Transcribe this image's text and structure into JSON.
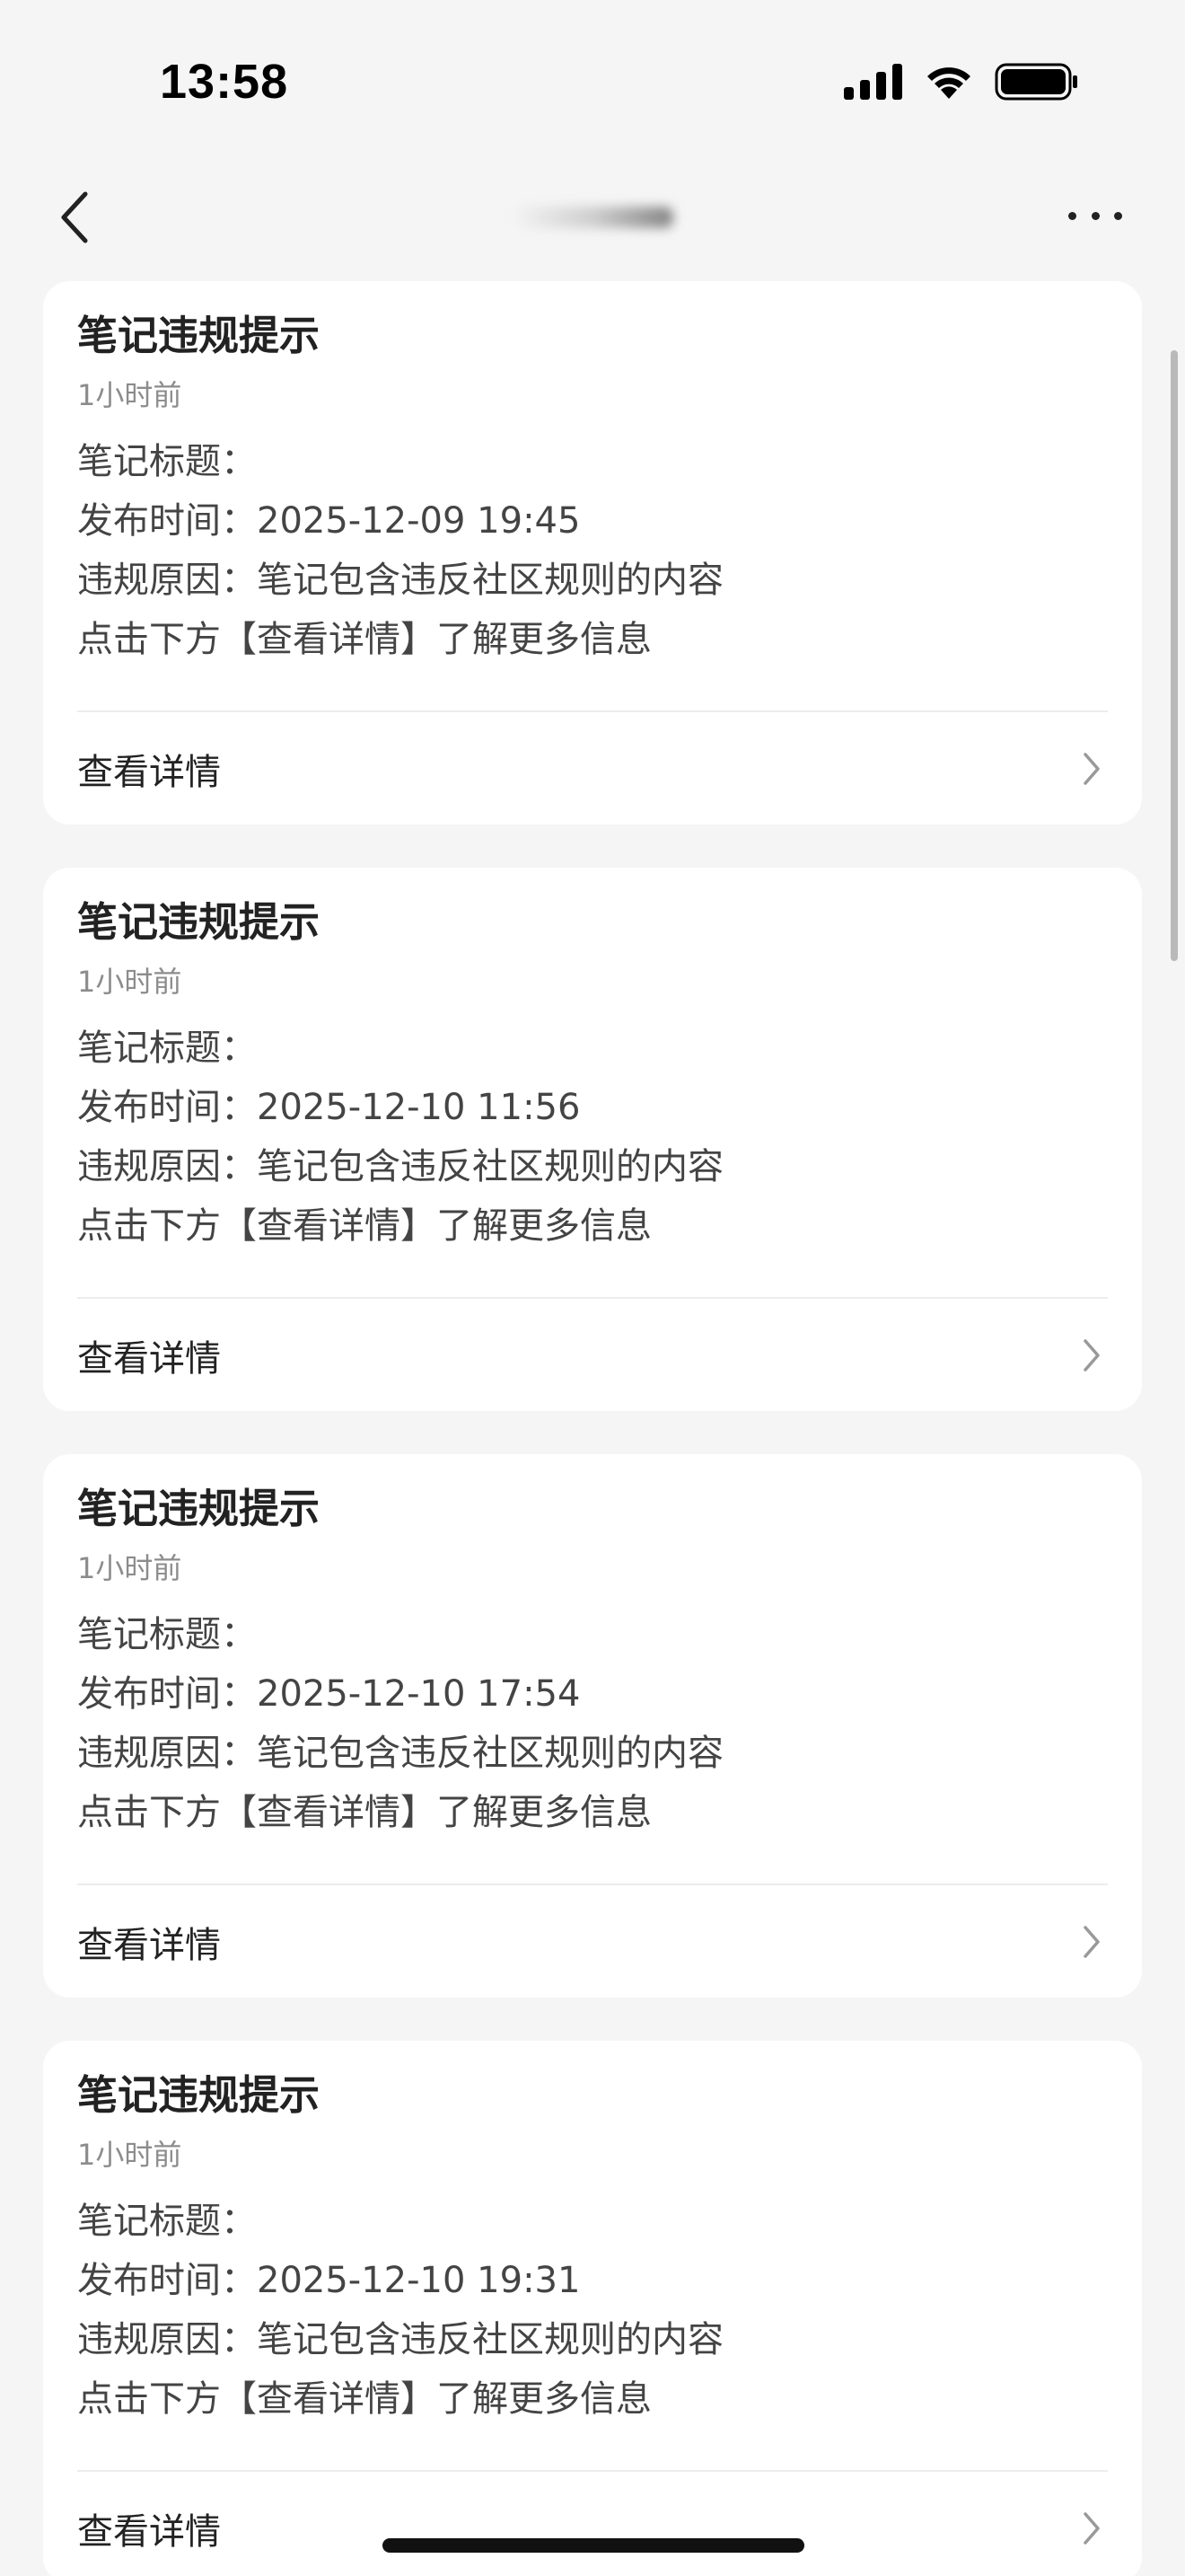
{
  "status_bar": {
    "time": "13:58",
    "icons": [
      "cellular-signal-icon",
      "wifi-icon",
      "battery-icon"
    ]
  },
  "nav": {
    "back_icon": "chevron-left-icon",
    "more_icon": "more-horizontal-icon"
  },
  "cards": [
    {
      "title": "笔记违规提示",
      "time_ago": "1小时前",
      "note_title_line": "笔记标题：",
      "publish_time_line": "发布时间：2025-12-09 19:45",
      "reason_line": "违规原因：笔记包含违反社区规则的内容",
      "hint_line": "点击下方【查看详情】了解更多信息",
      "action_label": "查看详情"
    },
    {
      "title": "笔记违规提示",
      "time_ago": "1小时前",
      "note_title_line": "笔记标题：",
      "publish_time_line": "发布时间：2025-12-10 11:56",
      "reason_line": "违规原因：笔记包含违反社区规则的内容",
      "hint_line": "点击下方【查看详情】了解更多信息",
      "action_label": "查看详情"
    },
    {
      "title": "笔记违规提示",
      "time_ago": "1小时前",
      "note_title_line": "笔记标题：",
      "publish_time_line": "发布时间：2025-12-10 17:54",
      "reason_line": "违规原因：笔记包含违反社区规则的内容",
      "hint_line": "点击下方【查看详情】了解更多信息",
      "action_label": "查看详情"
    },
    {
      "title": "笔记违规提示",
      "time_ago": "1小时前",
      "note_title_line": "笔记标题：",
      "publish_time_line": "发布时间：2025-12-10 19:31",
      "reason_line": "违规原因：笔记包含违反社区规则的内容",
      "hint_line": "点击下方【查看详情】了解更多信息",
      "action_label": "查看详情"
    }
  ],
  "colors": {
    "background": "#f5f5f5",
    "card": "#ffffff",
    "title_text": "#222222",
    "secondary_text": "#8c8c8c",
    "body_text": "#444444"
  }
}
